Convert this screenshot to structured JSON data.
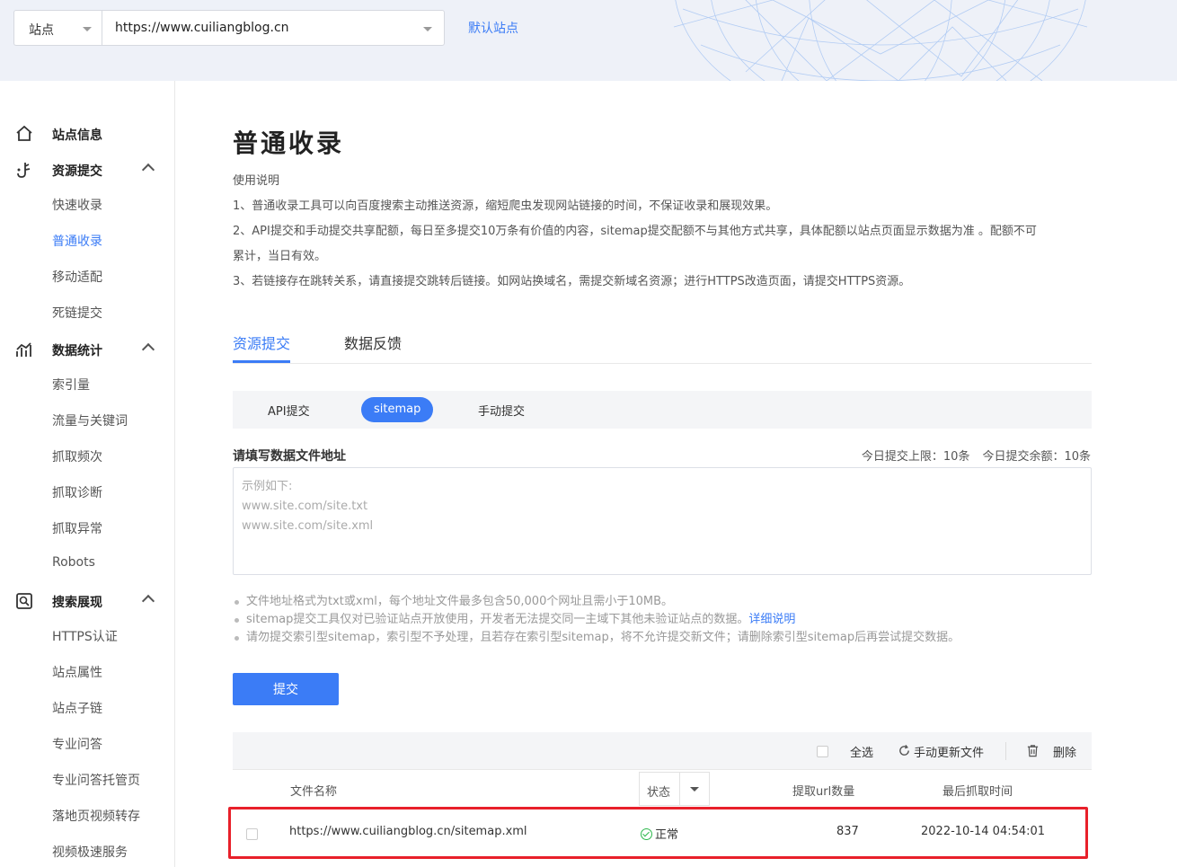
{
  "header": {
    "site_label": "站点",
    "site_url": "https://www.cuiliangblog.cn",
    "default_site_link": "默认站点"
  },
  "sidebar": {
    "groups": [
      {
        "title": "站点信息",
        "icon": "home-icon",
        "items": []
      },
      {
        "title": "资源提交",
        "icon": "submit-icon",
        "items": [
          "快速收录",
          "普通收录",
          "移动适配",
          "死链提交"
        ]
      },
      {
        "title": "数据统计",
        "icon": "chart-icon",
        "items": [
          "索引量",
          "流量与关键词",
          "抓取频次",
          "抓取诊断",
          "抓取异常",
          "Robots"
        ]
      },
      {
        "title": "搜索展现",
        "icon": "search-display-icon",
        "items": [
          "HTTPS认证",
          "站点属性",
          "站点子链",
          "专业问答",
          "专业问答托管页",
          "落地页视频转存",
          "视频极速服务"
        ]
      }
    ],
    "active_item": "普通收录"
  },
  "main": {
    "title": "普通收录",
    "instructions": [
      "使用说明",
      "1、普通收录工具可以向百度搜索主动推送资源，缩短爬虫发现网站链接的时间，不保证收录和展现效果。",
      "2、API提交和手动提交共享配额，每日至多提交10万条有价值的内容，sitemap提交配额不与其他方式共享，具体配额以站点页面显示数据为准 。配额不可",
      "累计，当日有效。",
      "3、若链接存在跳转关系，请直接提交跳转后链接。如网站换域名，需提交新域名资源；进行HTTPS改造页面，请提交HTTPS资源。"
    ],
    "tabs": [
      "资源提交",
      "数据反馈"
    ],
    "subtabs": [
      "API提交",
      "sitemap",
      "手动提交"
    ],
    "form_label": "请填写数据文件地址",
    "quota_limit": "今日提交上限：10条",
    "quota_remaining": "今日提交余额：10条",
    "textarea_placeholder": "示例如下:\nwww.site.com/site.txt\nwww.site.com/site.xml",
    "tips": [
      "文件地址格式为txt或xml，每个地址文件最多包含50,000个网址且需小于10MB。",
      "sitemap提交工具仅对已验证站点开放使用，开发者无法提交同一主域下其他未验证站点的数据。",
      "请勿提交索引型sitemap，索引型不予处理，且若存在索引型sitemap，将不允许提交新文件；请删除索引型sitemap后再尝试提交数据。"
    ],
    "tip_link": "详细说明",
    "submit_label": "提交"
  },
  "table": {
    "toolbar": {
      "select_all": "全选",
      "refresh": "手动更新文件",
      "delete": "删除"
    },
    "columns": {
      "file_name": "文件名称",
      "status": "状态",
      "url_count": "提取url数量",
      "last_crawl": "最后抓取时间"
    },
    "rows": [
      {
        "file_name": "https://www.cuiliangblog.cn/sitemap.xml",
        "status": "正常",
        "url_count": "837",
        "last_crawl": "2022-10-14 04:54:01"
      }
    ]
  },
  "colors": {
    "accent": "#3b7cf6",
    "highlight": "#e8202a",
    "ok": "#2db84d"
  }
}
